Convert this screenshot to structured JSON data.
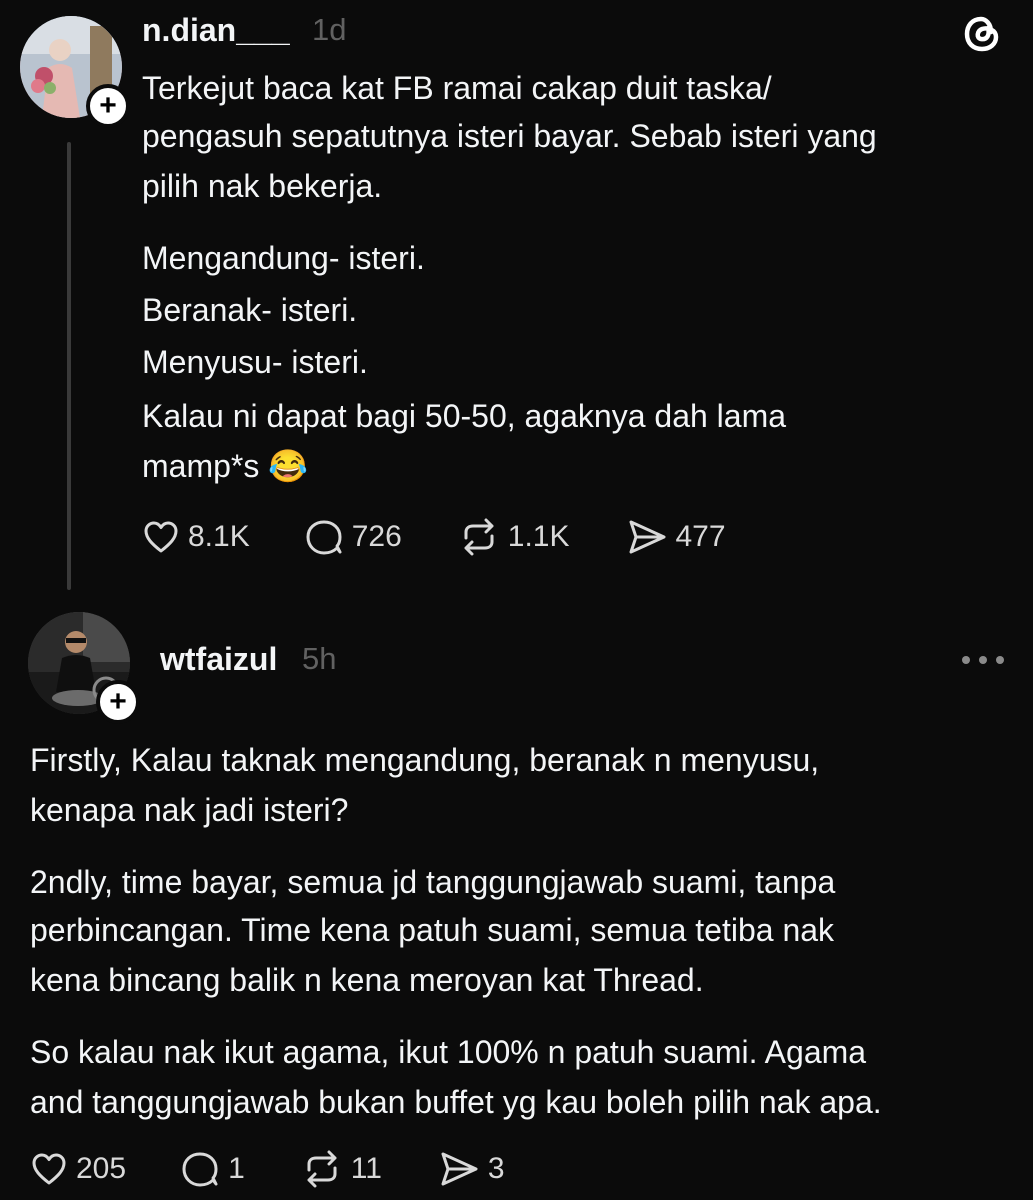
{
  "post": {
    "username": "n.dian___",
    "time": "1d",
    "lines": [
      "Terkejut baca kat FB ramai cakap duit taska/",
      "pengasuh sepatutnya isteri bayar. Sebab isteri yang",
      "pilih nak bekerja.",
      "Mengandung- isteri.",
      "Beranak- isteri.",
      "Menyusu- isteri.",
      "Kalau ni dapat bagi 50-50, agaknya dah lama",
      "mamp*s 😂"
    ],
    "likes": "8.1K",
    "replies": "726",
    "reposts": "1.1K",
    "shares": "477"
  },
  "reply": {
    "username": "wtfaizul",
    "time": "5h",
    "lines": [
      "Firstly, Kalau taknak mengandung, beranak n menyusu,",
      "kenapa nak jadi isteri?",
      "2ndly, time bayar, semua jd tanggungjawab suami, tanpa",
      "perbincangan. Time kena patuh suami, semua tetiba nak",
      "kena bincang balik n kena meroyan kat Thread.",
      "So kalau nak ikut agama, ikut 100% n patuh suami. Agama",
      "and tanggungjawab bukan buffet yg kau boleh pilih nak apa."
    ],
    "likes": "205",
    "replies": "1",
    "reposts": "11",
    "shares": "3"
  },
  "follow_badge": "+",
  "icons": {
    "app": "threads-logo-icon",
    "like": "heart-icon",
    "reply": "speech-bubble-icon",
    "repost": "repost-icon",
    "share": "send-icon",
    "more": "more-icon"
  },
  "colors": {
    "background": "#0b0b0b",
    "text": "#f3f5f7",
    "secondary": "#616161",
    "thread_line": "#3a3a3a"
  }
}
